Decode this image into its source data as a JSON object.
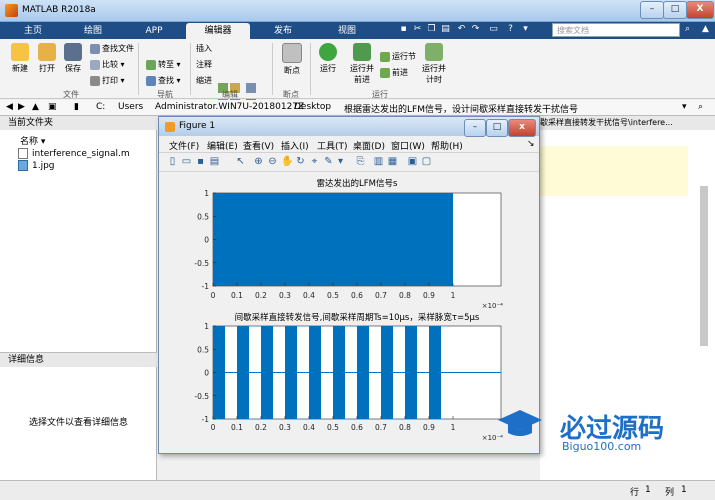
{
  "window": {
    "title": "MATLAB R2018a",
    "min_label": "–",
    "max_label": "□",
    "close_label": "X"
  },
  "tabs": [
    {
      "label": "主页"
    },
    {
      "label": "绘图"
    },
    {
      "label": "APP"
    },
    {
      "label": "编辑器"
    },
    {
      "label": "发布"
    },
    {
      "label": "视图"
    }
  ],
  "search": {
    "placeholder": "搜索文档"
  },
  "ribbon": {
    "new": "新建",
    "open": "打开",
    "save": "保存",
    "find_files": "查找文件",
    "compare": "比较",
    "print": "打印",
    "goto": "转至",
    "find": "查找",
    "insert": "插入",
    "comment": "注释",
    "indent": "缩进",
    "breakpoints": "断点",
    "run": "运行",
    "run_advance_1": "运行并",
    "run_advance_2": "前进",
    "run_section": "运行节",
    "advance": "前进",
    "run_time_1": "运行并",
    "run_time_2": "计时",
    "group_file": "文件",
    "group_nav": "导航",
    "group_edit": "编辑",
    "group_breakpoints": "断点",
    "group_run": "运行"
  },
  "address": {
    "crumbs": [
      "C:",
      "Users",
      "Administrator.WIN7U-20180127Z",
      "Desktop",
      "根据雷达发出的LFM信号，设计间歇采样直接转发干扰信号"
    ]
  },
  "folder_panel": {
    "title": "当前文件夹",
    "col_name": "名称",
    "files": [
      {
        "name": "interference_signal.m"
      },
      {
        "name": "1.jpg"
      }
    ]
  },
  "detail_panel": {
    "title": "详细信息",
    "hint": "选择文件以查看详细信息"
  },
  "right_panel": {
    "title": "歇采样直接转发干扰信号\\interfere..."
  },
  "status": {
    "row_label": "行",
    "row_value": "1",
    "col_label": "列",
    "col_value": "1"
  },
  "figure": {
    "title": "Figure 1",
    "menus": [
      "文件(F)",
      "编辑(E)",
      "查看(V)",
      "插入(I)",
      "工具(T)",
      "桌面(D)",
      "窗口(W)",
      "帮助(H)"
    ]
  },
  "watermark": {
    "brand": "必过源码",
    "url": "Biguo100.com"
  },
  "colors": {
    "accent": "#1f4d86",
    "plot": "#0072BD"
  },
  "chart_data": [
    {
      "type": "area",
      "title": "雷达发出的LFM信号s",
      "xlim": [
        0,
        1.2
      ],
      "ylim": [
        -1,
        1
      ],
      "x_ticks": [
        "0",
        "0.1",
        "0.2",
        "0.3",
        "0.4",
        "0.5",
        "0.6",
        "0.7",
        "0.8",
        "0.9",
        "1"
      ],
      "y_ticks": [
        "-1",
        "-0.5",
        "0",
        "0.5",
        "1"
      ],
      "x_multiplier": "×10⁻⁴",
      "series": [
        {
          "x_start": 0,
          "x_end": 1.0,
          "ymin": -1,
          "ymax": 1
        }
      ]
    },
    {
      "type": "area",
      "title": "间歇采样直接转发信号,间歇采样周期Ts=10μs，采样脉宽τ=5μs",
      "xlim": [
        0,
        1.2
      ],
      "ylim": [
        -1,
        1
      ],
      "x_ticks": [
        "0",
        "0.1",
        "0.2",
        "0.3",
        "0.4",
        "0.5",
        "0.6",
        "0.7",
        "0.8",
        "0.9",
        "1"
      ],
      "y_ticks": [
        "-1",
        "-0.5",
        "0",
        "0.5",
        "1"
      ],
      "x_multiplier": "×10⁻⁴",
      "period": 0.1,
      "pulse_width": 0.05,
      "series": [
        {
          "x_start": 0,
          "x_end": 1.0,
          "ymin": -1,
          "ymax": 1
        }
      ]
    }
  ]
}
